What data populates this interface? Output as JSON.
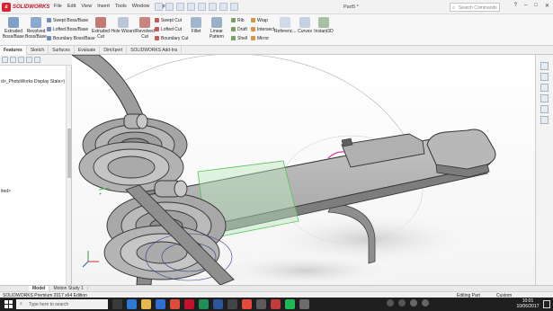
{
  "app": {
    "brand": "SOLIDWORKS",
    "document_title": "Part5 *"
  },
  "menu": [
    "File",
    "Edit",
    "View",
    "Insert",
    "Tools",
    "Window",
    "Help"
  ],
  "search": {
    "placeholder": "Search Commands"
  },
  "window_controls": [
    "?",
    "–",
    "□",
    "✕"
  ],
  "ribbon": {
    "extruded_boss": "Extruded Boss/Base",
    "revolved_boss": "Revolved Boss/Base",
    "swept_boss": "Swept Boss/Base",
    "lofted_boss": "Lofted Boss/Base",
    "boundary_boss": "Boundary Boss/Base",
    "extruded_cut": "Extruded Cut",
    "hole_wizard": "Hole Wizard",
    "revolved_cut": "Revolved Cut",
    "swept_cut": "Swept Cut",
    "lofted_cut": "Lofted Cut",
    "boundary_cut": "Boundary Cut",
    "fillet": "Fillet",
    "linear_pattern": "Linear Pattern",
    "rib": "Rib",
    "draft": "Draft",
    "shell": "Shell",
    "wrap": "Wrap",
    "intersect": "Intersect",
    "mirror": "Mirror",
    "reference": "Referenc...",
    "curves": "Curves",
    "instant3d": "Instant3D"
  },
  "command_tabs": [
    "Features",
    "Sketch",
    "Surfaces",
    "Evaluate",
    "DimXpert",
    "SOLIDWORKS Add-Ins"
  ],
  "feature_tree": {
    "display_state": "d>_PhotoWorks Display State>)",
    "item_text": "ited>"
  },
  "sheet_tabs": [
    "Model",
    "Motion Study 1"
  ],
  "status": {
    "product": "SOLIDWORKS Premium 2017 x64 Edition",
    "mode": "Editing Part",
    "units": "Custom"
  },
  "taskbar": {
    "search_placeholder": "Type here to search",
    "time": "10:01",
    "date": "10/06/2017"
  },
  "colors": {
    "brand_red": "#c8102e",
    "model_gray": "#a7a7a7",
    "selection_green": "#57c35a",
    "highlight_magenta": "#d02d9d",
    "taskbar": "#1f1f1f"
  }
}
